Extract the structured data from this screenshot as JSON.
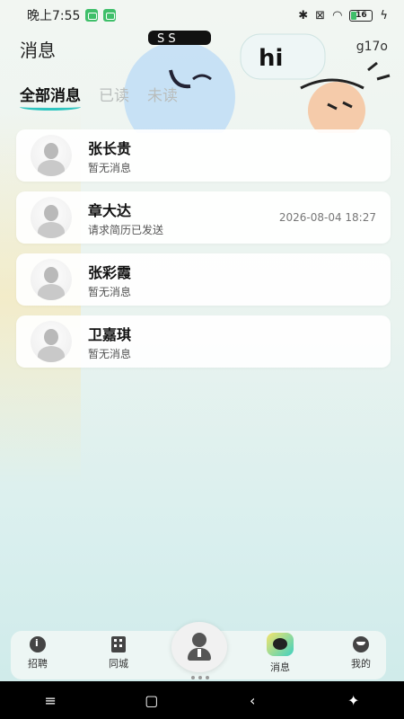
{
  "status_bar": {
    "time": "晚上7:55",
    "battery": "16"
  },
  "header": {
    "title": "消息",
    "user": "g17o",
    "deco_text": "hi"
  },
  "tabs": [
    {
      "label": "全部消息",
      "active": true
    },
    {
      "label": "已读",
      "active": false
    },
    {
      "label": "未读",
      "active": false
    }
  ],
  "messages": [
    {
      "name": "张长贵",
      "preview": "暂无消息",
      "time": ""
    },
    {
      "name": "章大达",
      "preview": "请求简历已发送",
      "time": "2026-08-04 18:27"
    },
    {
      "name": "张彩霞",
      "preview": "暂无消息",
      "time": ""
    },
    {
      "name": "卫嘉琪",
      "preview": "暂无消息",
      "time": ""
    }
  ],
  "bottom_nav": {
    "items": [
      {
        "label": "招聘",
        "icon": "info-icon"
      },
      {
        "label": "同城",
        "icon": "building-icon"
      },
      {
        "label": "消息",
        "icon": "chat-icon"
      },
      {
        "label": "我的",
        "icon": "profile-icon"
      }
    ],
    "center_icon": "worker-icon"
  },
  "colors": {
    "accent": "#2ec5c0",
    "brand_yellow": "#f5e46b"
  }
}
